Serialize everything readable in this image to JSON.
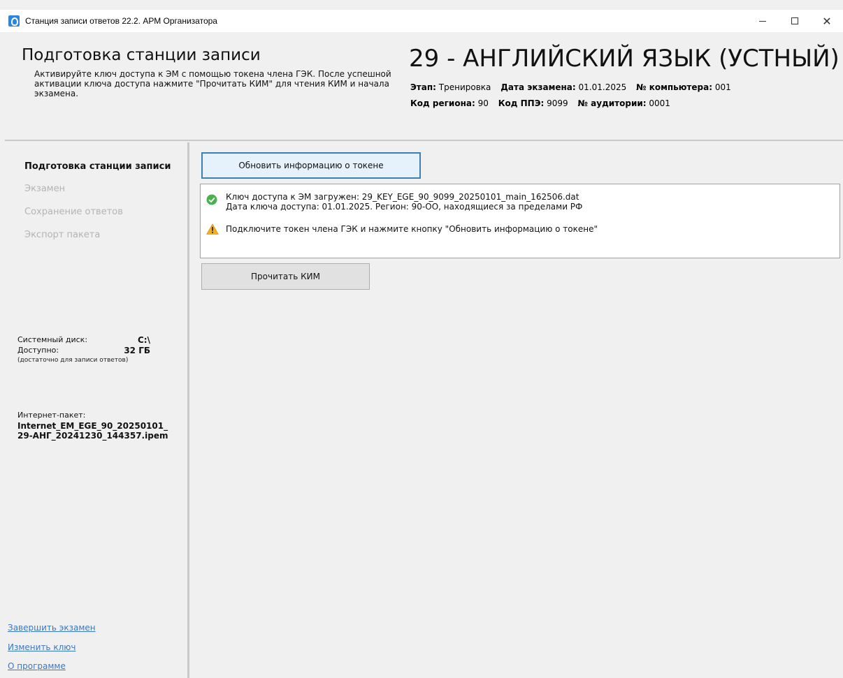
{
  "window": {
    "title": "Станция записи ответов 22.2. АРМ Организатора",
    "controls": {
      "minimize": "–",
      "maximize": "□",
      "close": "✕"
    }
  },
  "header": {
    "title": "Подготовка станции записи",
    "description": "Активируйте ключ доступа к ЭМ с помощью токена члена ГЭК. После успешной активации ключа доступа нажмите \"Прочитать КИМ\" для чтения КИМ и начала экзамена.",
    "subject": "29 - АНГЛИЙСКИЙ ЯЗЫК (УСТНЫЙ)",
    "meta": {
      "stage_label": "Этап:",
      "stage_value": "Тренировка",
      "exam_date_label": "Дата экзамена:",
      "exam_date_value": "01.01.2025",
      "computer_label": "№ компьютера:",
      "computer_value": "001",
      "region_label": "Код региона:",
      "region_value": "90",
      "ppe_label": "Код ППЭ:",
      "ppe_value": "9099",
      "room_label": "№ аудитории:",
      "room_value": "0001"
    }
  },
  "sidebar": {
    "nav": [
      {
        "label": "Подготовка станции записи",
        "state": "active"
      },
      {
        "label": "Экзамен",
        "state": "disabled"
      },
      {
        "label": "Сохранение ответов",
        "state": "disabled"
      },
      {
        "label": "Экспорт пакета",
        "state": "disabled"
      }
    ],
    "disk": {
      "system_label": "Системный диск:",
      "system_value": "C:\\",
      "free_label": "Доступно:",
      "free_value": "32 ГБ",
      "note": "(достаточно для записи ответов)"
    },
    "package": {
      "label": "Интернет-пакет:",
      "name": "Internet_EM_EGE_90_20250101_29-АНГ_20241230_144357.ipem"
    },
    "links": [
      "Завершить экзамен",
      "Изменить ключ",
      "О программе"
    ]
  },
  "main": {
    "update_button": "Обновить информацию о токене",
    "status": {
      "ok_line1": "Ключ доступа к ЭМ загружен: 29_KEY_EGE_90_9099_20250101_main_162506.dat",
      "ok_line2": "Дата ключа доступа: 01.01.2025. Регион: 90-ОО, находящиеся за пределами РФ",
      "warning": "Подключите токен члена ГЭК и нажмите кнопку \"Обновить информацию о токене\""
    },
    "read_button": "Прочитать КИМ"
  },
  "colors": {
    "accent": "#3c7fb1",
    "link": "#3a78c4",
    "disabled": "#b4b4b4",
    "ok": "#4caf50",
    "warning": "#f2b01e"
  }
}
